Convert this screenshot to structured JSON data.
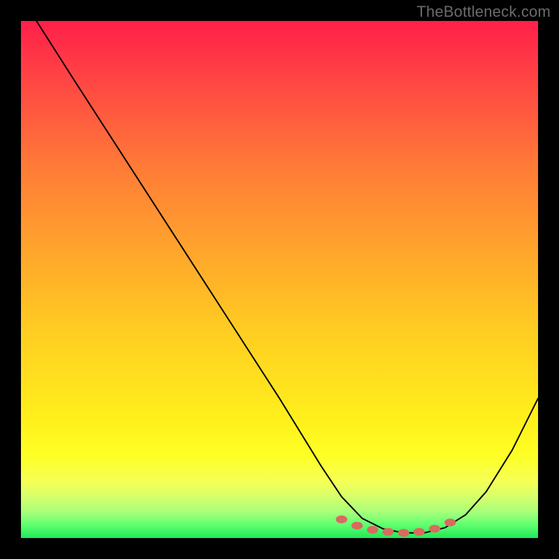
{
  "watermark": "TheBottleneck.com",
  "colors": {
    "page_bg": "#000000",
    "curve_stroke": "#000000",
    "marker_fill": "#d96a5f",
    "gradient_top": "#ff1f49",
    "gradient_bottom": "#1fe858"
  },
  "chart_data": {
    "type": "line",
    "title": "",
    "xlabel": "",
    "ylabel": "",
    "xlim": [
      0,
      100
    ],
    "ylim": [
      0,
      100
    ],
    "grid": false,
    "legend": false,
    "series": [
      {
        "name": "curve",
        "x": [
          3,
          10,
          20,
          30,
          40,
          50,
          58,
          62,
          66,
          70,
          74,
          78,
          82,
          86,
          90,
          95,
          100
        ],
        "y": [
          100,
          89,
          73.5,
          58,
          42.5,
          27,
          14,
          8,
          3.8,
          1.8,
          1.0,
          1.0,
          2.0,
          4.5,
          9,
          17,
          27
        ]
      }
    ],
    "markers": {
      "name": "highlight",
      "x": [
        62,
        65,
        68,
        71,
        74,
        77,
        80,
        83
      ],
      "y": [
        3.6,
        2.4,
        1.6,
        1.2,
        1.0,
        1.2,
        1.8,
        3.0
      ]
    }
  }
}
